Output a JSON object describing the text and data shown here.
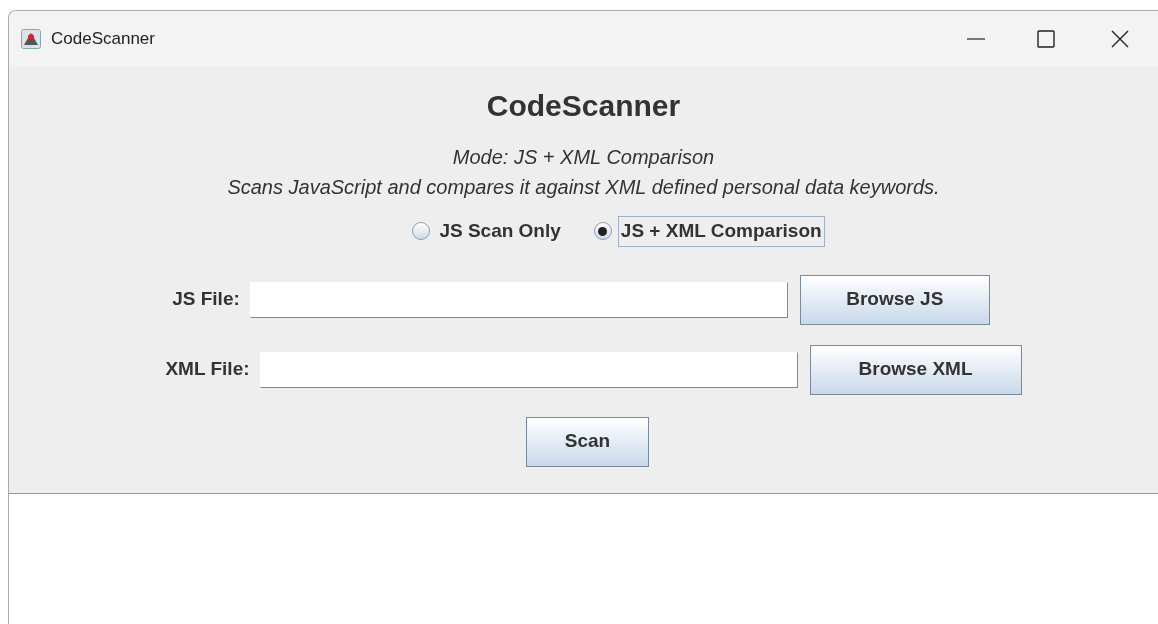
{
  "window": {
    "title": "CodeScanner"
  },
  "heading": "CodeScanner",
  "mode_line": "Mode: JS + XML Comparison",
  "description": "Scans JavaScript and compares it against XML defined personal data keywords.",
  "modes": [
    {
      "label": "JS Scan Only",
      "selected": false,
      "focused": false
    },
    {
      "label": "JS + XML Comparison",
      "selected": true,
      "focused": true
    }
  ],
  "fields": [
    {
      "label": "JS File:",
      "button": "Browse JS"
    },
    {
      "label": "XML File:",
      "button": "Browse XML"
    }
  ],
  "scan_button": "Scan"
}
